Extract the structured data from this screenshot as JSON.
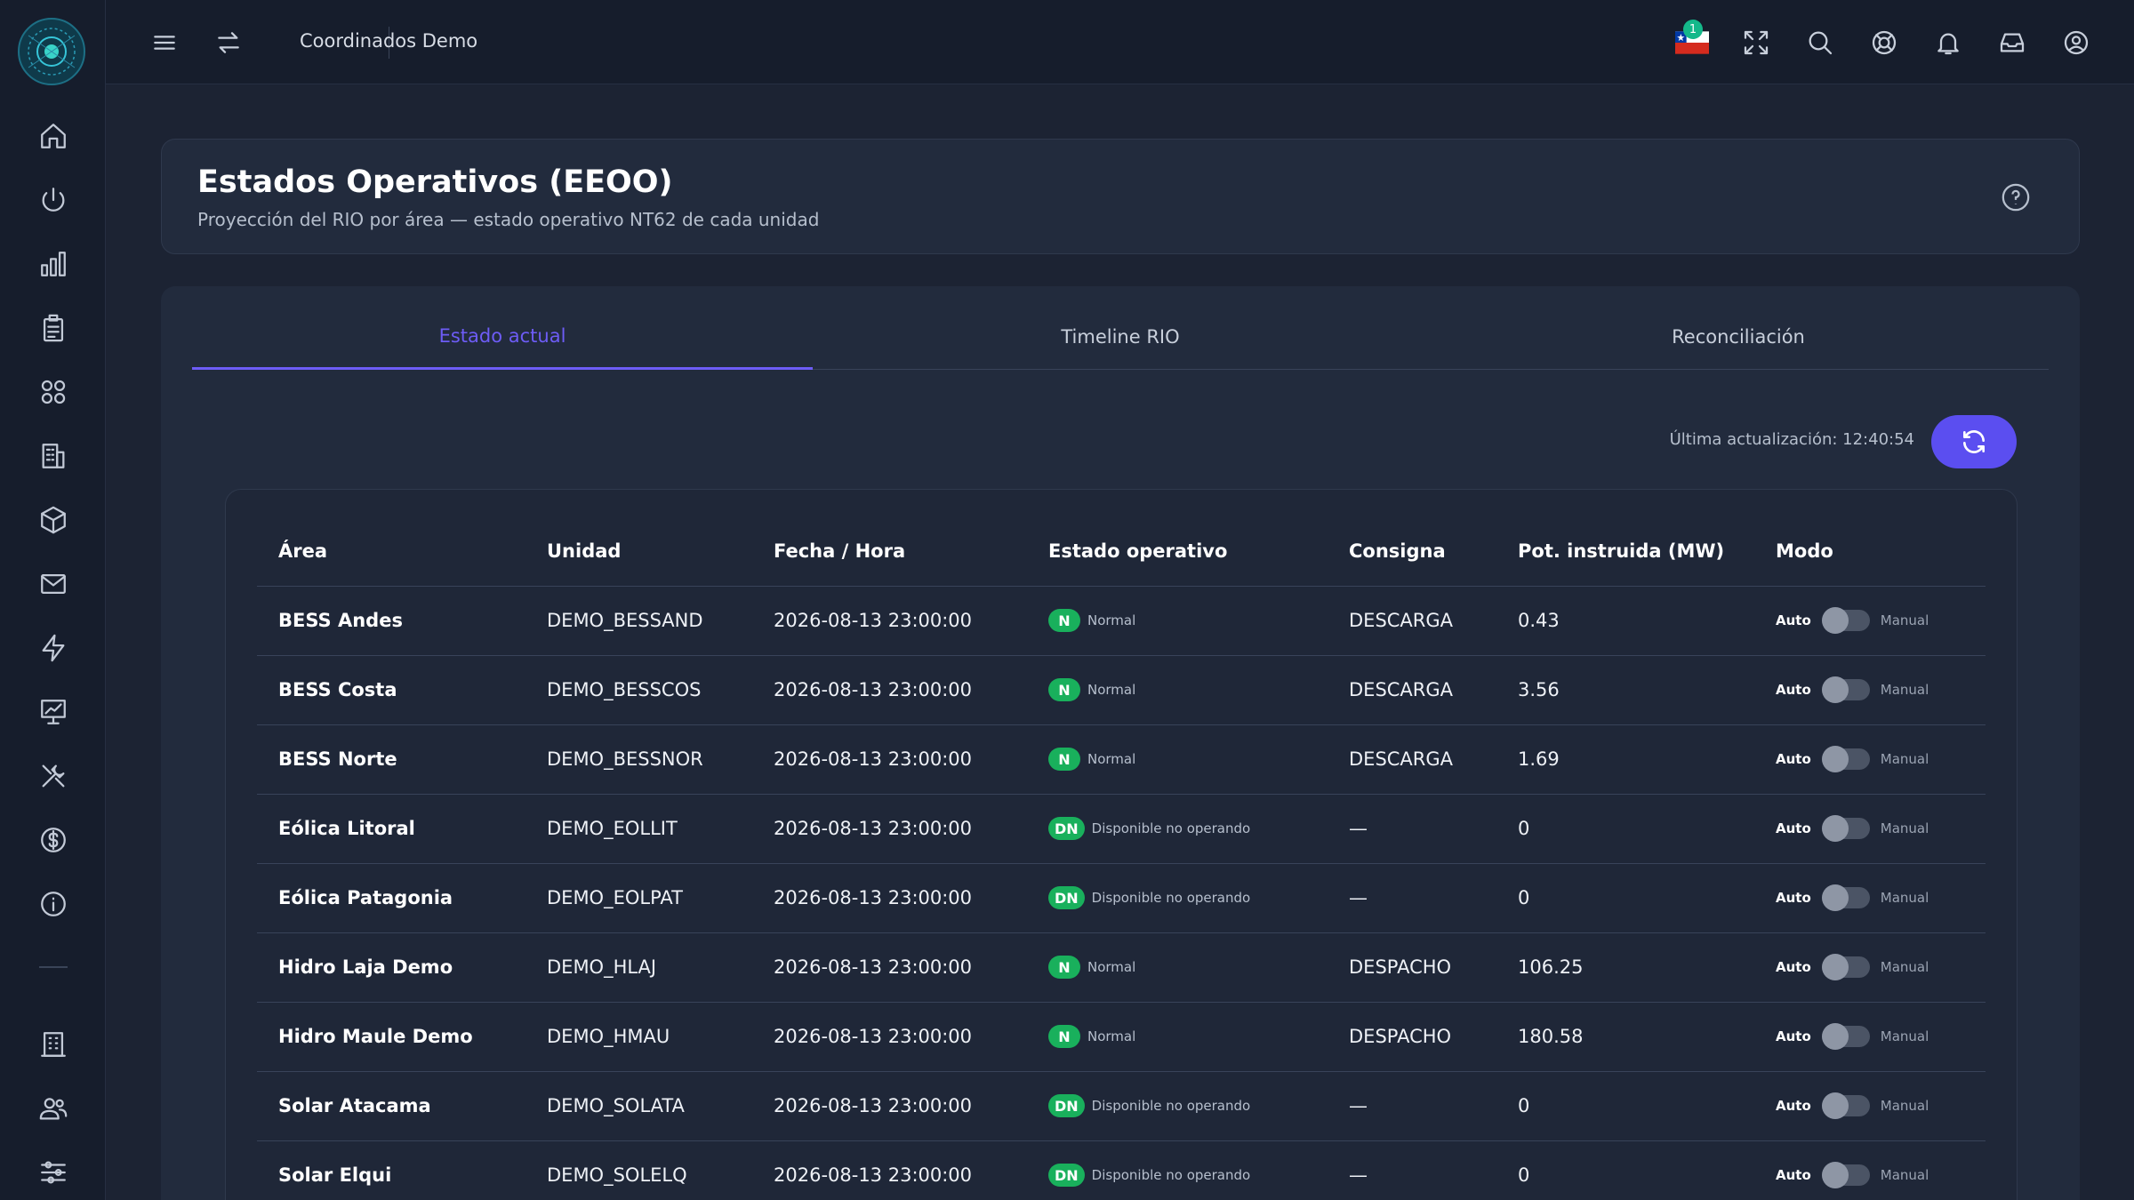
{
  "app": {
    "name": "Coordinados Demo"
  },
  "sidebar": {
    "items": [
      {
        "icon": "home-icon"
      },
      {
        "icon": "power-icon"
      },
      {
        "icon": "bar-chart-icon"
      },
      {
        "icon": "clipboard-icon"
      },
      {
        "icon": "grid-icon"
      },
      {
        "icon": "building-icon"
      },
      {
        "icon": "cube-icon"
      },
      {
        "icon": "mail-icon"
      },
      {
        "icon": "bolt-icon"
      },
      {
        "icon": "presentation-chart-icon"
      },
      {
        "icon": "tools-icon"
      },
      {
        "icon": "dollar-icon"
      },
      {
        "icon": "info-icon"
      },
      {
        "icon": "office-icon"
      },
      {
        "icon": "users-icon"
      },
      {
        "icon": "sliders-icon"
      }
    ]
  },
  "topbar": {
    "title": "Coordinados Demo",
    "notification_count": "1",
    "accent": "#14b88a"
  },
  "header": {
    "title": "Estados Operativos (EEOO)",
    "subtitle": "Proyección del RIO por área — estado operativo NT62 de cada unidad"
  },
  "tabs": [
    {
      "label": "Estado actual",
      "active": true
    },
    {
      "label": "Timeline RIO",
      "active": false
    },
    {
      "label": "Reconciliación",
      "active": false
    }
  ],
  "last_update": "Última actualización: 12:40:54",
  "table": {
    "columns": [
      "Área",
      "Unidad",
      "Fecha / Hora",
      "Estado operativo",
      "Consigna",
      "Pot. instruida (MW)",
      "Modo"
    ],
    "mode_labels": {
      "auto": "Auto",
      "manual": "Manual"
    },
    "rows": [
      {
        "area": "BESS Andes",
        "unidad": "DEMO_BESSAND",
        "fecha": "2026-08-13 23:00:00",
        "estado_code": "N",
        "estado_text": "Normal",
        "consigna": "DESCARGA",
        "pot": "0.43"
      },
      {
        "area": "BESS Costa",
        "unidad": "DEMO_BESSCOS",
        "fecha": "2026-08-13 23:00:00",
        "estado_code": "N",
        "estado_text": "Normal",
        "consigna": "DESCARGA",
        "pot": "3.56"
      },
      {
        "area": "BESS Norte",
        "unidad": "DEMO_BESSNOR",
        "fecha": "2026-08-13 23:00:00",
        "estado_code": "N",
        "estado_text": "Normal",
        "consigna": "DESCARGA",
        "pot": "1.69"
      },
      {
        "area": "Eólica Litoral",
        "unidad": "DEMO_EOLLIT",
        "fecha": "2026-08-13 23:00:00",
        "estado_code": "DN",
        "estado_text": "Disponible no operando",
        "consigna": "—",
        "pot": "0"
      },
      {
        "area": "Eólica Patagonia",
        "unidad": "DEMO_EOLPAT",
        "fecha": "2026-08-13 23:00:00",
        "estado_code": "DN",
        "estado_text": "Disponible no operando",
        "consigna": "—",
        "pot": "0"
      },
      {
        "area": "Hidro Laja Demo",
        "unidad": "DEMO_HLAJ",
        "fecha": "2026-08-13 23:00:00",
        "estado_code": "N",
        "estado_text": "Normal",
        "consigna": "DESPACHO",
        "pot": "106.25"
      },
      {
        "area": "Hidro Maule Demo",
        "unidad": "DEMO_HMAU",
        "fecha": "2026-08-13 23:00:00",
        "estado_code": "N",
        "estado_text": "Normal",
        "consigna": "DESPACHO",
        "pot": "180.58"
      },
      {
        "area": "Solar Atacama",
        "unidad": "DEMO_SOLATA",
        "fecha": "2026-08-13 23:00:00",
        "estado_code": "DN",
        "estado_text": "Disponible no operando",
        "consigna": "—",
        "pot": "0"
      },
      {
        "area": "Solar Elqui",
        "unidad": "DEMO_SOLELQ",
        "fecha": "2026-08-13 23:00:00",
        "estado_code": "DN",
        "estado_text": "Disponible no operando",
        "consigna": "—",
        "pot": "0"
      }
    ]
  },
  "colors": {
    "accent": "#5b4ef0",
    "status_green": "#19b05c",
    "background": "#1c2333"
  }
}
